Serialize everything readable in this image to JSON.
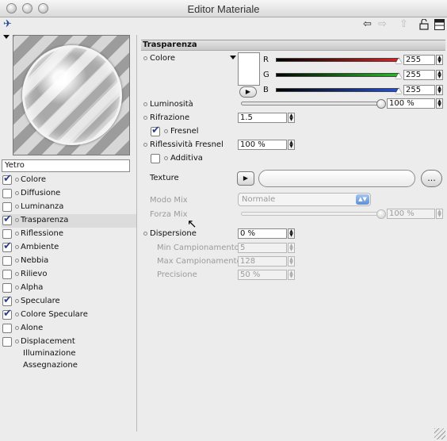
{
  "window": {
    "title": "Editor Materiale"
  },
  "toolbar": {
    "pin_icon": "pin-icon",
    "back_icon": "arrow-left-icon",
    "forward_icon": "arrow-right-icon",
    "up_icon": "arrow-up-icon",
    "lock_icon": "lock-open-icon",
    "panel_icon": "panel-layout-icon"
  },
  "material": {
    "name": "Yetro"
  },
  "channels": [
    {
      "label": "Colore",
      "checked": true
    },
    {
      "label": "Diffusione",
      "checked": false
    },
    {
      "label": "Luminanza",
      "checked": false
    },
    {
      "label": "Trasparenza",
      "checked": true,
      "selected": true
    },
    {
      "label": "Riflessione",
      "checked": false
    },
    {
      "label": "Ambiente",
      "checked": true
    },
    {
      "label": "Nebbia",
      "checked": false
    },
    {
      "label": "Rilievo",
      "checked": false
    },
    {
      "label": "Alpha",
      "checked": false
    },
    {
      "label": "Speculare",
      "checked": true
    },
    {
      "label": "Colore Speculare",
      "checked": true
    },
    {
      "label": "Alone",
      "checked": false
    },
    {
      "label": "Displacement",
      "checked": false
    }
  ],
  "extra_items": [
    "Illuminazione",
    "Assegnazione"
  ],
  "section": {
    "title": "Trasparenza"
  },
  "color": {
    "label": "Colore",
    "r_label": "R",
    "g_label": "G",
    "b_label": "B",
    "r_value": "255",
    "g_value": "255",
    "b_value": "255",
    "r_fraction": 1.0,
    "g_fraction": 1.0,
    "b_fraction": 1.0
  },
  "luminosita": {
    "label": "Luminosità",
    "value": "100 %",
    "fraction": 1.0
  },
  "rifrazione": {
    "label": "Rifrazione",
    "value": "1.5"
  },
  "fresnel": {
    "label": "Fresnel",
    "checked": true
  },
  "riflessivita": {
    "label": "Riflessività Fresnel",
    "value": "100 %"
  },
  "additiva": {
    "label": "Additiva",
    "checked": false
  },
  "texture": {
    "label": "Texture",
    "button_label": "..."
  },
  "modo_mix": {
    "label": "Modo Mix",
    "value": "Normale"
  },
  "forza_mix": {
    "label": "Forza Mix",
    "value": "100 %",
    "fraction": 1.0
  },
  "dispersione": {
    "label": "Dispersione",
    "value": "0 %"
  },
  "min_campionamento": {
    "label": "Min Campionamento",
    "value": "5"
  },
  "max_campionamento": {
    "label": "Max Campionamento",
    "value": "128"
  },
  "precisione": {
    "label": "Precisione",
    "value": "50 %"
  },
  "colors": {
    "red_bar_end": "#e02020",
    "green_bar_end": "#20c020",
    "blue_bar_end": "#2050e0",
    "selection_arrow": "#5f8fd6"
  }
}
